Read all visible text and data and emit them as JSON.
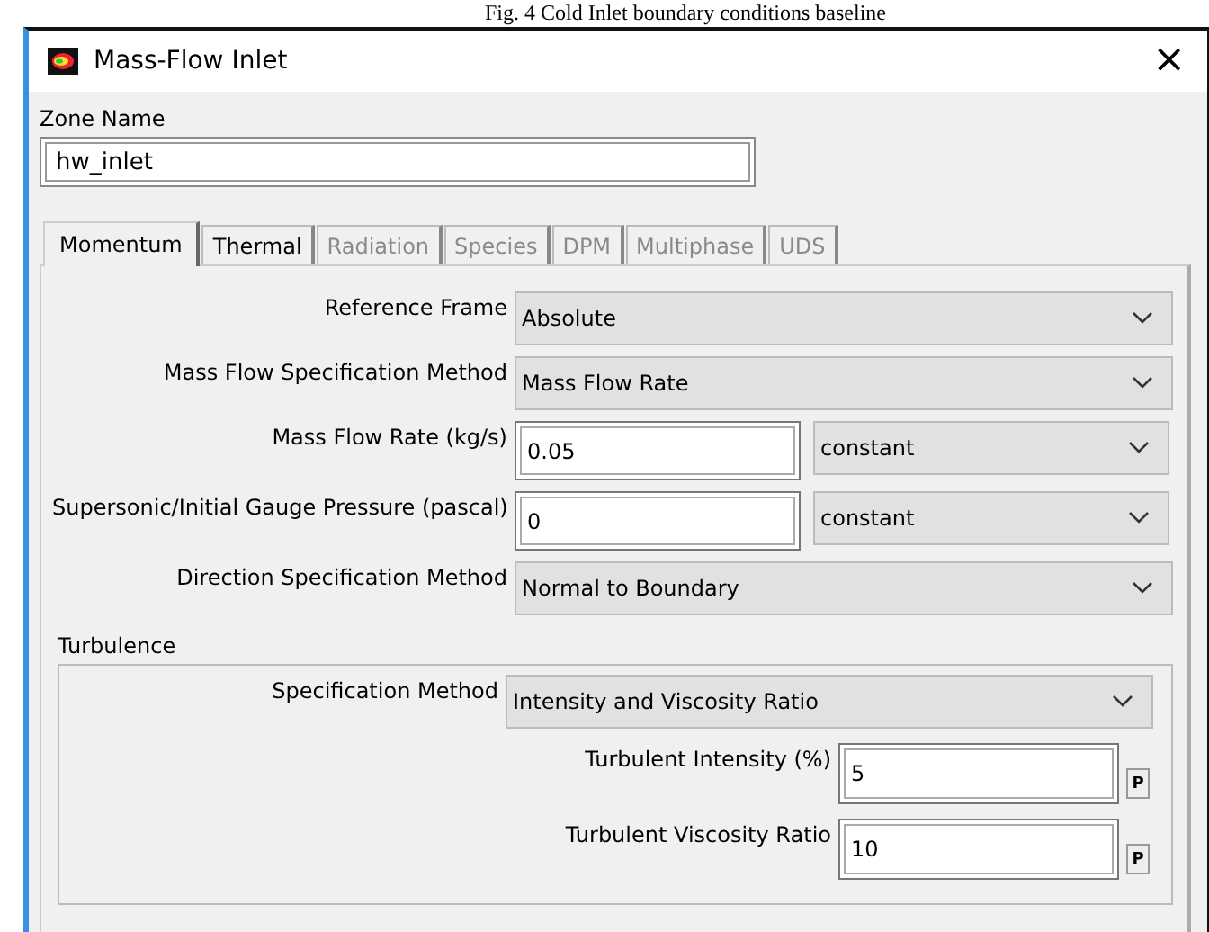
{
  "caption": "Fig. 4 Cold Inlet boundary conditions baseline",
  "window": {
    "title": "Mass-Flow Inlet",
    "close": "×"
  },
  "zone": {
    "label": "Zone Name",
    "value": "hw_inlet"
  },
  "tabs": [
    {
      "label": "Momentum",
      "selected": true,
      "disabled": false
    },
    {
      "label": "Thermal",
      "selected": false,
      "disabled": false
    },
    {
      "label": "Radiation",
      "selected": false,
      "disabled": true
    },
    {
      "label": "Species",
      "selected": false,
      "disabled": true
    },
    {
      "label": "DPM",
      "selected": false,
      "disabled": true
    },
    {
      "label": "Multiphase",
      "selected": false,
      "disabled": true
    },
    {
      "label": "UDS",
      "selected": false,
      "disabled": true
    }
  ],
  "rows": [
    {
      "kind": "dropdown",
      "label": "Reference Frame",
      "value": "Absolute"
    },
    {
      "kind": "dropdown",
      "label": "Mass Flow Specification Method",
      "value": "Mass Flow Rate"
    },
    {
      "kind": "input",
      "label": "Mass Flow Rate (kg/s)",
      "value": "0.05",
      "profile": "constant"
    },
    {
      "kind": "input",
      "label": "Supersonic/Initial Gauge Pressure (pascal)",
      "value": "0",
      "profile": "constant"
    },
    {
      "kind": "dropdown",
      "label": "Direction Specification Method",
      "value": "Normal to Boundary"
    }
  ],
  "turbulence": {
    "label": "Turbulence",
    "method_label": "Specification Method",
    "method": "Intensity and Viscosity Ratio",
    "params": [
      {
        "label": "Turbulent Intensity (%)",
        "value": "5",
        "param_button": "P"
      },
      {
        "label": "Turbulent Viscosity Ratio",
        "value": "10",
        "param_button": "P"
      }
    ]
  }
}
